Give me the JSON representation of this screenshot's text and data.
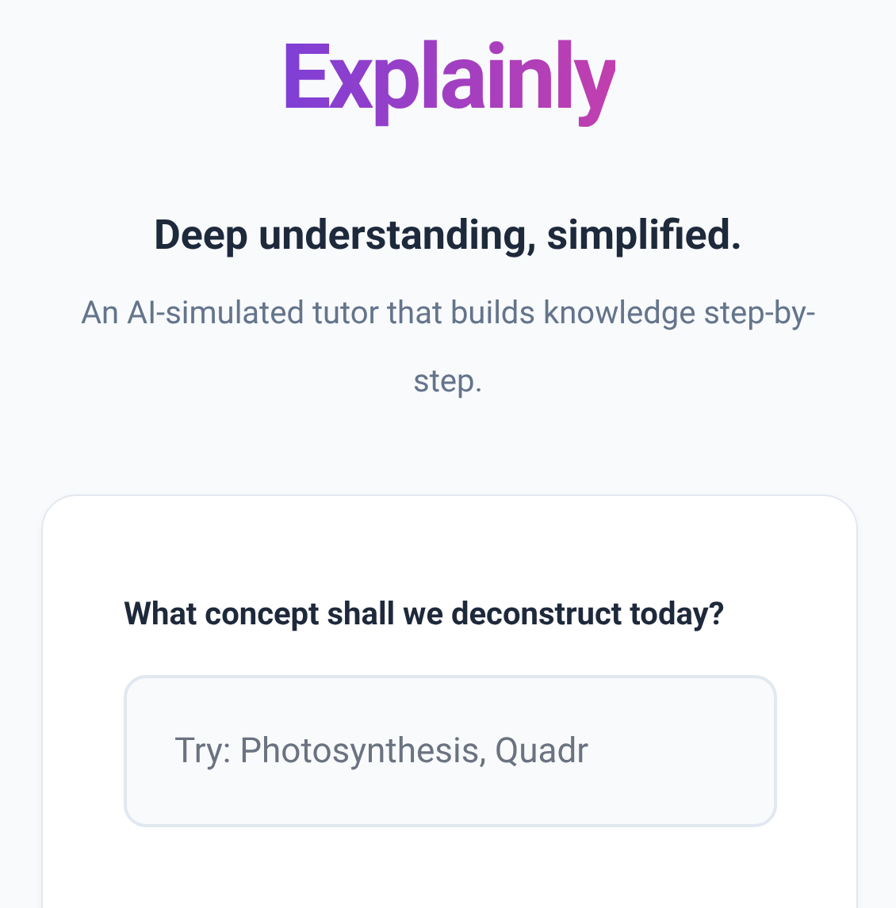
{
  "logo": "Explainly",
  "headline": "Deep understanding, simplified.",
  "subtitle": "An AI-simulated tutor that builds knowledge step-by-step.",
  "card": {
    "label": "What concept shall we deconstruct today?",
    "input": {
      "placeholder": "Try: Photosynthesis, Quadr"
    }
  }
}
